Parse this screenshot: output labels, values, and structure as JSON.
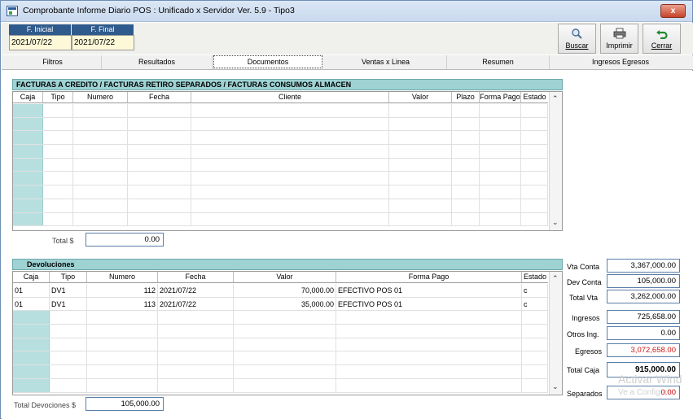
{
  "window": {
    "title": "Comprobante Informe Diario POS : Unificado x Servidor  Ver. 5.9 - Tipo3",
    "close_label": "x"
  },
  "dates": {
    "start_label": "F. Inicial",
    "end_label": "F. Final",
    "start_value": "2021/07/22",
    "end_value": "2021/07/22"
  },
  "toolbar": {
    "search": {
      "label": "Buscar",
      "icon": "magnifier-icon"
    },
    "print": {
      "label": "Imprimir",
      "icon": "printer-icon"
    },
    "close": {
      "label": "Cerrar",
      "icon": "undo-arrow-icon"
    }
  },
  "tabs": [
    "Filtros",
    "Resultados",
    "Documentos",
    "Ventas x Linea",
    "Resumen",
    "Ingresos  Egresos"
  ],
  "active_tab": "Documentos",
  "facturas": {
    "title": "FACTURAS A  CREDITO  /  FACTURAS  RETIRO SEPARADOS /  FACTURAS CONSUMOS ALMACEN",
    "columns": [
      "Caja",
      "Tipo",
      "Numero",
      "Fecha",
      "Cliente",
      "Valor",
      "Plazo",
      "Forma Pago",
      "Estado"
    ],
    "total_label": "Total  $",
    "total_value": "0.00"
  },
  "devoluciones": {
    "title": "Devoluciones",
    "columns": [
      "Caja",
      "Tipo",
      "Numero",
      "Fecha",
      "Valor",
      "Forma Pago",
      "Estado"
    ],
    "rows": [
      [
        "01",
        "DV1",
        "112",
        "2021/07/22",
        "70,000.00",
        "EFECTIVO POS 01",
        "c"
      ],
      [
        "01",
        "DV1",
        "113",
        "2021/07/22",
        "35,000.00",
        "EFECTIVO POS 01",
        "c"
      ]
    ],
    "total_label": "Total Devociones $",
    "total_value": "105,000.00"
  },
  "summary": {
    "vta_conta_label": "Vta Conta",
    "vta_conta": "3,367,000.00",
    "dev_conta_label": "Dev Conta",
    "dev_conta": "105,000.00",
    "total_vta_label": "Total Vta",
    "total_vta": "3,262,000.00",
    "ingresos_label": "Ingresos",
    "ingresos": "725,658.00",
    "otros_label": "Otros Ing.",
    "otros": "0.00",
    "egresos_label": "Egresos",
    "egresos": "3,072,658.00",
    "total_caja_label": "Total Caja",
    "total_caja": "915,000.00",
    "separados_label": "Separados",
    "separados": "0.00"
  },
  "watermark": {
    "line1": "Activar Wind",
    "line2": "Ve a Configurac"
  },
  "colors": {
    "header_blue": "#2f5a8c",
    "section_teal": "#9ed2d3",
    "negative_red": "#d01818"
  }
}
